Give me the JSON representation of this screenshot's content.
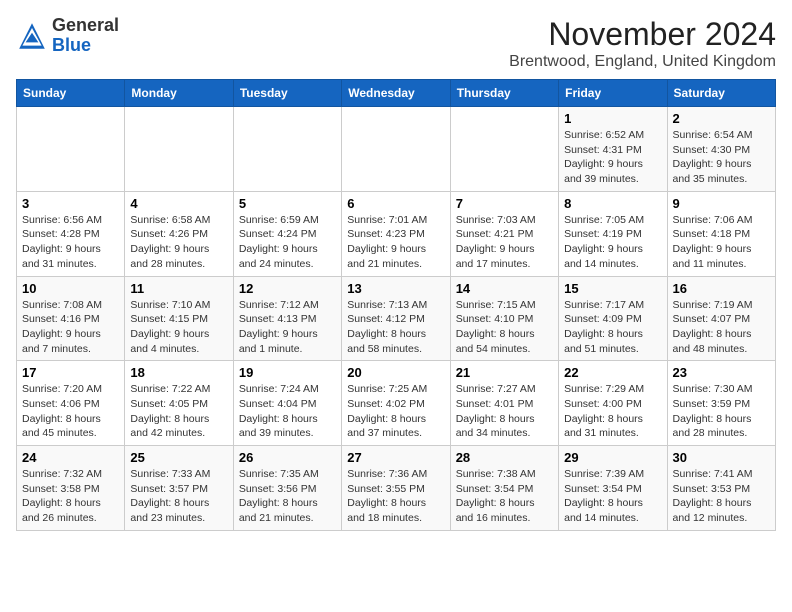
{
  "header": {
    "logo_line1": "General",
    "logo_line2": "Blue",
    "title": "November 2024",
    "subtitle": "Brentwood, England, United Kingdom"
  },
  "days_of_week": [
    "Sunday",
    "Monday",
    "Tuesday",
    "Wednesday",
    "Thursday",
    "Friday",
    "Saturday"
  ],
  "weeks": [
    [
      {
        "day": "",
        "info": ""
      },
      {
        "day": "",
        "info": ""
      },
      {
        "day": "",
        "info": ""
      },
      {
        "day": "",
        "info": ""
      },
      {
        "day": "",
        "info": ""
      },
      {
        "day": "1",
        "info": "Sunrise: 6:52 AM\nSunset: 4:31 PM\nDaylight: 9 hours and 39 minutes."
      },
      {
        "day": "2",
        "info": "Sunrise: 6:54 AM\nSunset: 4:30 PM\nDaylight: 9 hours and 35 minutes."
      }
    ],
    [
      {
        "day": "3",
        "info": "Sunrise: 6:56 AM\nSunset: 4:28 PM\nDaylight: 9 hours and 31 minutes."
      },
      {
        "day": "4",
        "info": "Sunrise: 6:58 AM\nSunset: 4:26 PM\nDaylight: 9 hours and 28 minutes."
      },
      {
        "day": "5",
        "info": "Sunrise: 6:59 AM\nSunset: 4:24 PM\nDaylight: 9 hours and 24 minutes."
      },
      {
        "day": "6",
        "info": "Sunrise: 7:01 AM\nSunset: 4:23 PM\nDaylight: 9 hours and 21 minutes."
      },
      {
        "day": "7",
        "info": "Sunrise: 7:03 AM\nSunset: 4:21 PM\nDaylight: 9 hours and 17 minutes."
      },
      {
        "day": "8",
        "info": "Sunrise: 7:05 AM\nSunset: 4:19 PM\nDaylight: 9 hours and 14 minutes."
      },
      {
        "day": "9",
        "info": "Sunrise: 7:06 AM\nSunset: 4:18 PM\nDaylight: 9 hours and 11 minutes."
      }
    ],
    [
      {
        "day": "10",
        "info": "Sunrise: 7:08 AM\nSunset: 4:16 PM\nDaylight: 9 hours and 7 minutes."
      },
      {
        "day": "11",
        "info": "Sunrise: 7:10 AM\nSunset: 4:15 PM\nDaylight: 9 hours and 4 minutes."
      },
      {
        "day": "12",
        "info": "Sunrise: 7:12 AM\nSunset: 4:13 PM\nDaylight: 9 hours and 1 minute."
      },
      {
        "day": "13",
        "info": "Sunrise: 7:13 AM\nSunset: 4:12 PM\nDaylight: 8 hours and 58 minutes."
      },
      {
        "day": "14",
        "info": "Sunrise: 7:15 AM\nSunset: 4:10 PM\nDaylight: 8 hours and 54 minutes."
      },
      {
        "day": "15",
        "info": "Sunrise: 7:17 AM\nSunset: 4:09 PM\nDaylight: 8 hours and 51 minutes."
      },
      {
        "day": "16",
        "info": "Sunrise: 7:19 AM\nSunset: 4:07 PM\nDaylight: 8 hours and 48 minutes."
      }
    ],
    [
      {
        "day": "17",
        "info": "Sunrise: 7:20 AM\nSunset: 4:06 PM\nDaylight: 8 hours and 45 minutes."
      },
      {
        "day": "18",
        "info": "Sunrise: 7:22 AM\nSunset: 4:05 PM\nDaylight: 8 hours and 42 minutes."
      },
      {
        "day": "19",
        "info": "Sunrise: 7:24 AM\nSunset: 4:04 PM\nDaylight: 8 hours and 39 minutes."
      },
      {
        "day": "20",
        "info": "Sunrise: 7:25 AM\nSunset: 4:02 PM\nDaylight: 8 hours and 37 minutes."
      },
      {
        "day": "21",
        "info": "Sunrise: 7:27 AM\nSunset: 4:01 PM\nDaylight: 8 hours and 34 minutes."
      },
      {
        "day": "22",
        "info": "Sunrise: 7:29 AM\nSunset: 4:00 PM\nDaylight: 8 hours and 31 minutes."
      },
      {
        "day": "23",
        "info": "Sunrise: 7:30 AM\nSunset: 3:59 PM\nDaylight: 8 hours and 28 minutes."
      }
    ],
    [
      {
        "day": "24",
        "info": "Sunrise: 7:32 AM\nSunset: 3:58 PM\nDaylight: 8 hours and 26 minutes."
      },
      {
        "day": "25",
        "info": "Sunrise: 7:33 AM\nSunset: 3:57 PM\nDaylight: 8 hours and 23 minutes."
      },
      {
        "day": "26",
        "info": "Sunrise: 7:35 AM\nSunset: 3:56 PM\nDaylight: 8 hours and 21 minutes."
      },
      {
        "day": "27",
        "info": "Sunrise: 7:36 AM\nSunset: 3:55 PM\nDaylight: 8 hours and 18 minutes."
      },
      {
        "day": "28",
        "info": "Sunrise: 7:38 AM\nSunset: 3:54 PM\nDaylight: 8 hours and 16 minutes."
      },
      {
        "day": "29",
        "info": "Sunrise: 7:39 AM\nSunset: 3:54 PM\nDaylight: 8 hours and 14 minutes."
      },
      {
        "day": "30",
        "info": "Sunrise: 7:41 AM\nSunset: 3:53 PM\nDaylight: 8 hours and 12 minutes."
      }
    ]
  ]
}
